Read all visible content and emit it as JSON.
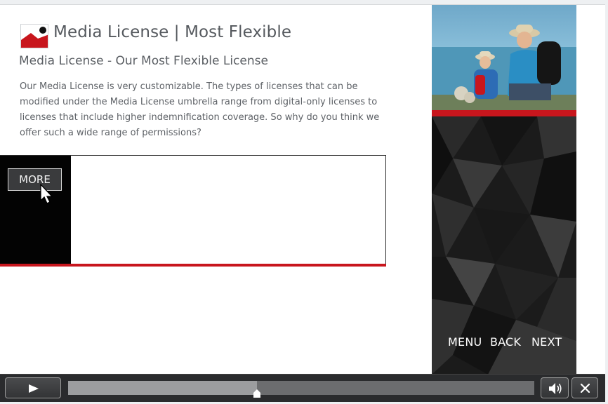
{
  "header": {
    "title": "Media License | Most Flexible",
    "logo_icon": "mountain-sun-logo-icon"
  },
  "content": {
    "subtitle": "Media License - Our Most Flexible License",
    "body": "Our Media License is very customizable.  The types of licenses that can be modified under the Media License umbrella range from digital-only licenses  to licenses that include higher indemnification coverage.  So why do you think we offer such a wide range of permissions?"
  },
  "panel": {
    "more_label": "MORE"
  },
  "navigation": {
    "menu_label": "MENU",
    "back_label": "BACK",
    "next_label": "NEXT"
  },
  "player": {
    "play_icon": "play-icon",
    "volume_icon": "volume-icon",
    "close_icon": "close-icon",
    "progress": 0.405
  },
  "colors": {
    "accent_red": "#c8161d",
    "text_gray": "#5b5f64",
    "panel_black": "#030303",
    "playbar": "#2a2b2d"
  }
}
